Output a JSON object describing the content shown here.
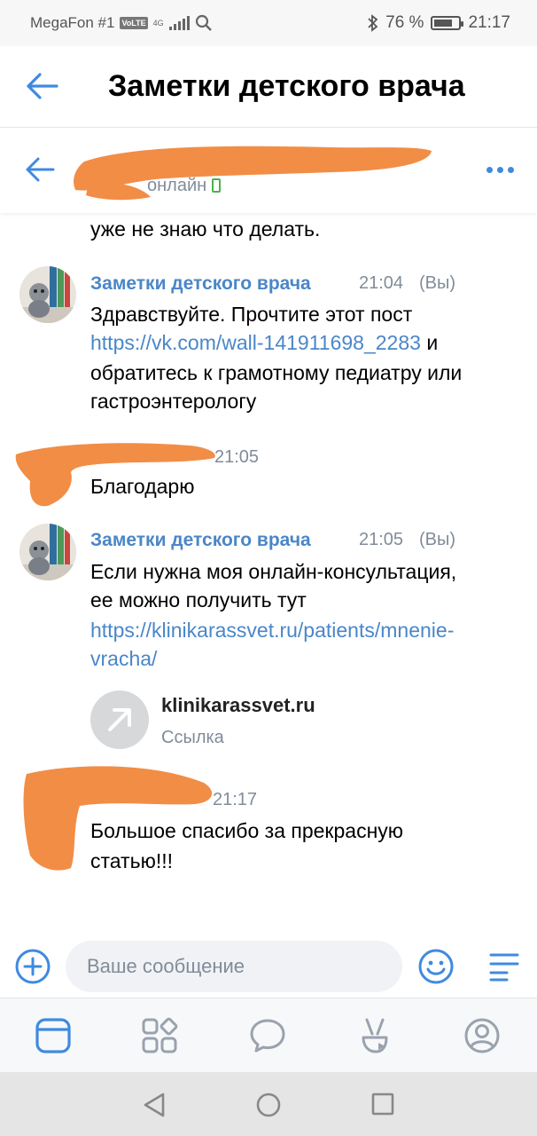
{
  "status_bar": {
    "carrier": "MegaFon #1",
    "volte": "VoLTE",
    "network": "4G",
    "battery": "76 %",
    "battery_level": 0.76,
    "time": "21:17"
  },
  "header": {
    "title": "Заметки детского врача"
  },
  "chat_header": {
    "presence": "онлайн"
  },
  "messages": [
    {
      "text": "уже не знаю что делать."
    },
    {
      "author": "Заметки детского врача",
      "time": "21:04",
      "you": "(Вы)",
      "text_before": "Здравствуйте. Прочтите этот пост",
      "link": "https://vk.com/wall-141911698_2283",
      "text_after_1": "и",
      "text_after_2": "обратитесь к грамотному педиатру или",
      "text_after_3": "гастроэнтерологу"
    },
    {
      "time": "21:05",
      "text": "Благодарю"
    },
    {
      "author": "Заметки детского врача",
      "time": "21:05",
      "you": "(Вы)",
      "line1": "Если нужна моя онлайн-консультация,",
      "line2": "ее можно получить тут",
      "link_line1": "https://klinikarassvet.ru/patients/mnenie-",
      "link_line2": "vracha/",
      "attachment": {
        "title": "klinikarassvet.ru",
        "subtitle": "Ссылка"
      }
    },
    {
      "time": "21:17",
      "line1": "Большое спасибо за прекрасную",
      "line2": "статью!!!"
    }
  ],
  "composer": {
    "placeholder": "Ваше сообщение"
  },
  "icons": {
    "back": "back-arrow-icon",
    "more": "more-dots-icon",
    "add": "plus-circle-icon",
    "emoji": "smile-icon",
    "menu": "menu-lines-icon",
    "tabs": [
      "news-icon",
      "services-icon",
      "messages-icon",
      "clips-icon",
      "profile-icon"
    ],
    "nav": [
      "nav-back-icon",
      "nav-home-icon",
      "nav-recents-icon"
    ]
  },
  "colors": {
    "accent": "#3f8ae0",
    "link": "#4a86c8",
    "secondary_text": "#818c99",
    "redaction": "#f28d46",
    "online": "#4bb34b"
  }
}
